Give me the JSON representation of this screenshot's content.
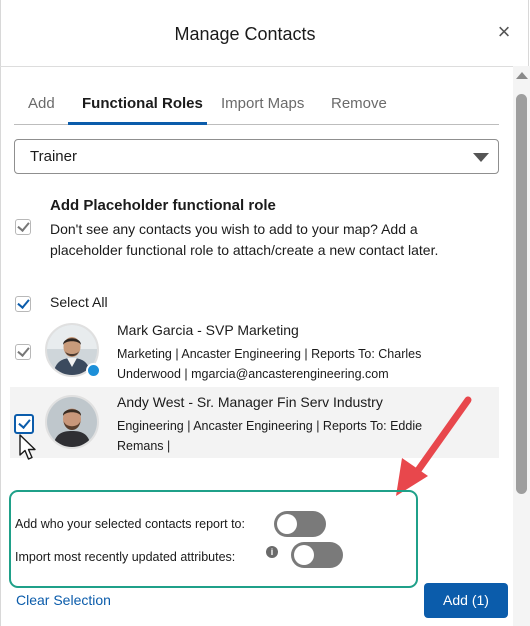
{
  "dialog": {
    "title": "Manage Contacts",
    "close_glyph": "×"
  },
  "tabs": [
    {
      "label": "Add",
      "active": false
    },
    {
      "label": "Functional Roles",
      "active": true
    },
    {
      "label": "Import Maps",
      "active": false
    },
    {
      "label": "Remove",
      "active": false
    }
  ],
  "role_select": {
    "value": "Trainer"
  },
  "placeholder": {
    "title": "Add Placeholder functional role",
    "description": "Don't see any contacts you wish to add to your map? Add a placeholder functional role to attach/create a new contact later.",
    "checked": true
  },
  "select_all": {
    "label": "Select All",
    "checked": true
  },
  "contacts": [
    {
      "name": "Mark Garcia  - SVP Marketing",
      "meta_line1": "Marketing | Ancaster Engineering | Reports To: Charles",
      "meta_line2": "Underwood | mgarcia@ancasterengineering.com",
      "checked": true
    },
    {
      "name": "Andy West  - Sr. Manager Fin Serv Industry",
      "meta_line1": "Engineering | Ancaster Engineering | Reports To: Eddie",
      "meta_line2": "Remans |",
      "checked": true
    }
  ],
  "options": {
    "report_to_label": "Add who your selected contacts report to:",
    "report_to_on": false,
    "import_attrs_label": "Import most recently updated attributes:",
    "import_attrs_on": false,
    "info_glyph": "i"
  },
  "footer": {
    "clear_label": "Clear Selection",
    "add_label": "Add (1)"
  },
  "colors": {
    "accent": "#0b5cab",
    "highlight_box": "#1fa089",
    "arrow": "#e8474c"
  }
}
